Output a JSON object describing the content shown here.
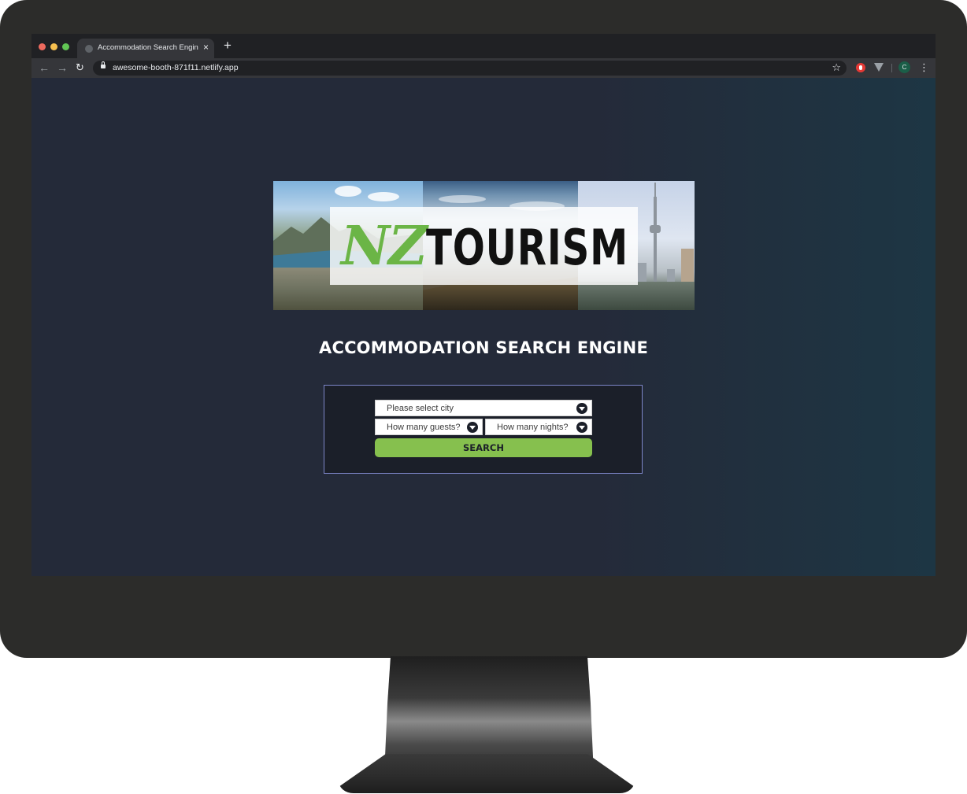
{
  "browser": {
    "tab_title": "Accommodation Search Engine",
    "url": "awesome-booth-871f11.netlify.app",
    "new_tab_label": "+",
    "close_label": "×",
    "profile_initial": "C"
  },
  "icons": [
    "back-arrow-icon",
    "forward-arrow-icon",
    "reload-icon",
    "lock-icon",
    "star-icon",
    "adblock-icon",
    "vue-devtools-icon",
    "menu-icon",
    "chevron-down-icon"
  ],
  "colors": {
    "page_background": "#242a39",
    "accent_green": "#86c04e",
    "panel_border": "#7d86c9"
  },
  "banner": {
    "logo_nz": "NZ",
    "logo_tourism": "TOURISM"
  },
  "page": {
    "title": "ACCOMMODATION SEARCH ENGINE"
  },
  "search": {
    "city_placeholder": "Please select city",
    "guests_placeholder": "How many guests?",
    "nights_placeholder": "How many nights?",
    "button_label": "SEARCH"
  }
}
